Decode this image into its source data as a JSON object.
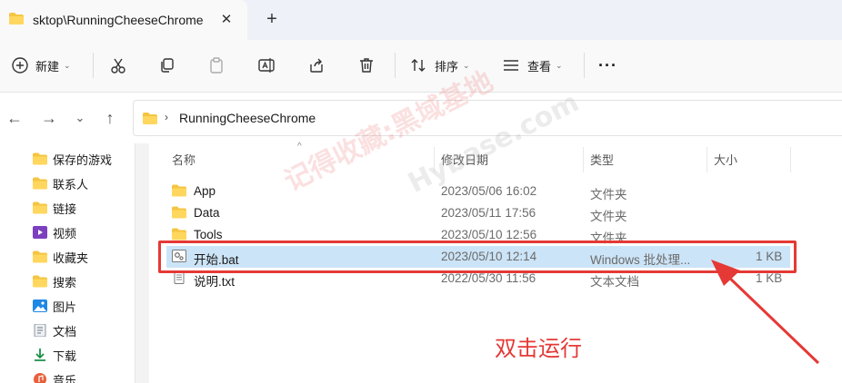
{
  "tab": {
    "title": "sktop\\RunningCheeseChrome",
    "close_glyph": "✕",
    "new_tab_glyph": "+"
  },
  "toolbar": {
    "new_label": "新建",
    "sort_label": "排序",
    "view_label": "查看",
    "more_glyph": "···"
  },
  "address": {
    "path": "RunningCheeseChrome"
  },
  "sidebar": {
    "items": [
      {
        "label": "保存的游戏",
        "icon": "folder-icon"
      },
      {
        "label": "联系人",
        "icon": "folder-icon"
      },
      {
        "label": "链接",
        "icon": "folder-icon"
      },
      {
        "label": "视频",
        "icon": "video-icon"
      },
      {
        "label": "收藏夹",
        "icon": "folder-icon"
      },
      {
        "label": "搜索",
        "icon": "folder-icon"
      },
      {
        "label": "图片",
        "icon": "picture-icon"
      },
      {
        "label": "文档",
        "icon": "document-icon"
      },
      {
        "label": "下载",
        "icon": "download-icon"
      },
      {
        "label": "音乐",
        "icon": "music-icon"
      }
    ]
  },
  "columns": {
    "name": "名称",
    "modified": "修改日期",
    "type": "类型",
    "size": "大小"
  },
  "files": [
    {
      "name": "App",
      "modified": "2023/05/06 16:02",
      "type": "文件夹",
      "size": "",
      "icon": "folder-icon"
    },
    {
      "name": "Data",
      "modified": "2023/05/11 17:56",
      "type": "文件夹",
      "size": "",
      "icon": "folder-icon"
    },
    {
      "name": "Tools",
      "modified": "2023/05/10 12:56",
      "type": "文件夹",
      "size": "",
      "icon": "folder-icon"
    },
    {
      "name": "开始.bat",
      "modified": "2023/05/10 12:14",
      "type": "Windows 批处理...",
      "size": "1 KB",
      "icon": "batch-file-icon"
    },
    {
      "name": "说明.txt",
      "modified": "2022/05/30 11:56",
      "type": "文本文档",
      "size": "1 KB",
      "icon": "text-file-icon"
    }
  ],
  "annotation": {
    "text": "双击运行"
  },
  "watermark": {
    "text": "记得收藏:黑域基地",
    "text2": "Hybase.com"
  },
  "colors": {
    "folder": "#f4c542",
    "accent": "#0067c0",
    "selection": "#cce4f7",
    "annotation": "#e53935"
  }
}
